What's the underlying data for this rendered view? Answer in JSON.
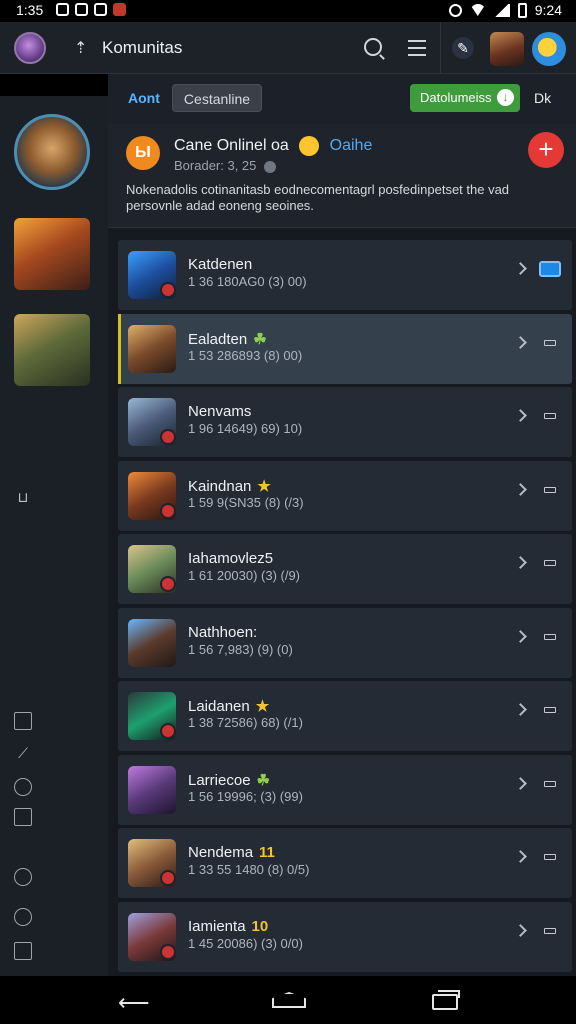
{
  "statusbar": {
    "time": "1:35",
    "clock_right": "9:24"
  },
  "appbar": {
    "title": "Komunitas"
  },
  "filters": {
    "tab1": "Aont",
    "tab2": "Cestanline",
    "action": "Datolumeiss",
    "more": "Dk"
  },
  "post": {
    "title": "Cane Onlinel oa",
    "tag": "Oaihe",
    "subtitle": "Borader: 3, 25",
    "body": "Nokenadolis cotinanitasb eodnecomentagrl posfedinpetset the vad persovnle adad eoneng seoines.",
    "avatar_letter": "Ы"
  },
  "rows": [
    {
      "name": "Katdenen",
      "icon": "",
      "meta": "1 36 180AG0 (3) 00)"
    },
    {
      "name": "Ealadten",
      "icon": "☘",
      "meta": "1 53 286893 (8) 00)"
    },
    {
      "name": "Nenvams",
      "icon": "",
      "meta": "1 96 14649) 69) 10)"
    },
    {
      "name": "Kaindnan",
      "icon": "★",
      "meta": "1 59 9(SN35 (8) (/3)"
    },
    {
      "name": "Iahamovlez5",
      "icon": "",
      "meta": "1 61 20030) (3) (/9)"
    },
    {
      "name": "Nathhoen:",
      "icon": "",
      "meta": "1 56 7,983) (9) (0)"
    },
    {
      "name": "Laidanen",
      "icon": "★",
      "meta": "1 38 72586) 68) (/1)"
    },
    {
      "name": "Larriecoe",
      "icon": "☘",
      "meta": "1 56 19996; (3) (99)"
    },
    {
      "name": "Nendema",
      "icon": "11",
      "meta": "1 33 55 1480 (8) 0/5)"
    },
    {
      "name": "Iamienta",
      "icon": "10",
      "meta": "1 45 20086) (3) 0/0)"
    }
  ],
  "colors": {
    "accent_blue": "#1e88e5",
    "green": "#3f9c3c",
    "red": "#e53935",
    "highlight": "#d2c21e"
  }
}
